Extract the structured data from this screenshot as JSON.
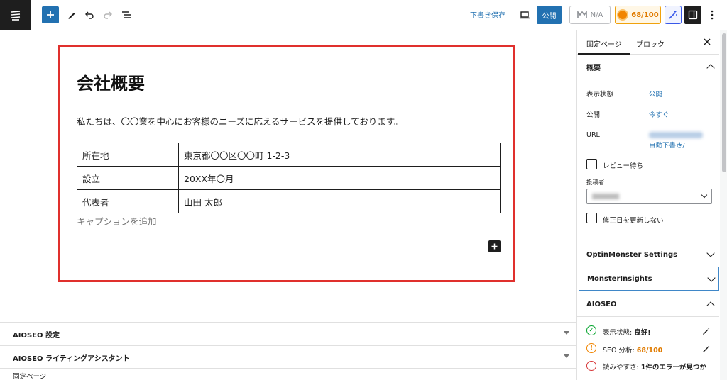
{
  "toolbar": {
    "draft_save": "下書き保存",
    "publish": "公開",
    "na_label": "N/A",
    "seo_score": "68/100"
  },
  "content": {
    "title": "会社概要",
    "intro": "私たちは、〇〇業を中心にお客様のニーズに応えるサービスを提供しております。",
    "table": [
      {
        "key": "所在地",
        "value": "東京都〇〇区〇〇町 1-2-3"
      },
      {
        "key": "設立",
        "value": "20XX年〇月"
      },
      {
        "key": "代表者",
        "value": "山田 太郎"
      }
    ],
    "caption_placeholder": "キャプションを追加"
  },
  "metaboxes": [
    {
      "label": "AIOSEO 設定"
    },
    {
      "label": "AIOSEO ライティングアシスタント"
    }
  ],
  "footer": {
    "breadcrumb": "固定ページ"
  },
  "sidebar": {
    "tabs": [
      "固定ページ",
      "ブロック"
    ],
    "summary": {
      "heading": "概要",
      "visibility_label": "表示状態",
      "visibility_value": "公開",
      "publish_label": "公開",
      "publish_value": "今すぐ",
      "url_label": "URL",
      "url_value": "自動下書き/",
      "pending_review": "レビュー待ち",
      "author_label": "投稿者",
      "no_modified": "修正日を更新しない"
    },
    "panels": {
      "optinmonster": "OptinMonster Settings",
      "monsterinsights": "MonsterInsights",
      "aioseo": "AIOSEO"
    },
    "aioseo": {
      "display_label": "表示状態:",
      "display_value": "良好!",
      "seo_label": "SEO 分析:",
      "seo_value": "68/100",
      "read_label": "読みやすさ:",
      "read_value": "1件のエラーが見つか"
    }
  },
  "colors": {
    "accent": "#2271b1",
    "highlight_frame": "#e0302d",
    "score_orange": "#f18500",
    "good_green": "#00a32a"
  }
}
